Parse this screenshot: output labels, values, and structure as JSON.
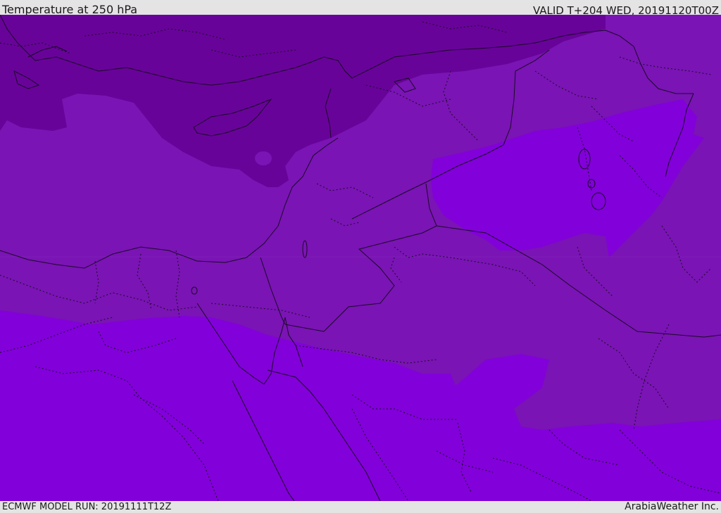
{
  "header": {
    "title": "Temperature at 250 hPa",
    "valid_time": "VALID T+204 WED, 20191120T00Z"
  },
  "footer": {
    "model_run": "ECMWF MODEL RUN: 20191111T12Z",
    "credit": "ArabiaWeather Inc."
  },
  "map": {
    "colors": {
      "cold_band": "#680399",
      "mid_band": "#7a14b4",
      "warm_band": "#8200d9",
      "border_line": "#1a0a26"
    }
  }
}
